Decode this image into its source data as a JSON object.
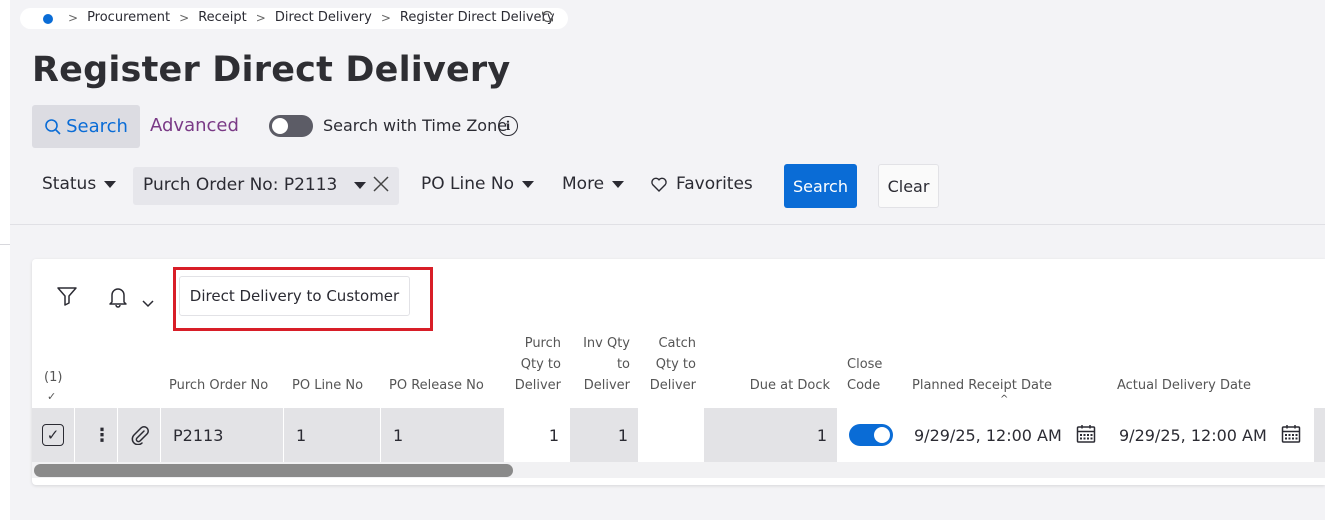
{
  "breadcrumb": {
    "items": [
      "Procurement",
      "Receipt",
      "Direct Delivery",
      "Register Direct Delivery"
    ],
    "separator": ">",
    "refresh_icon": "refresh-icon"
  },
  "page_title": "Register Direct Delivery",
  "search_modes": {
    "search_label": "Search",
    "advanced_label": "Advanced",
    "time_zone_label": "Search with Time Zone",
    "time_zone_enabled": false,
    "info_glyph": "i"
  },
  "filters": {
    "status_label": "Status",
    "purch_order_chip": "Purch Order No: P2113",
    "po_line_label": "PO Line No",
    "more_label": "More",
    "favorites_label": "Favorites",
    "search_button": "Search",
    "clear_button": "Clear"
  },
  "toolbar": {
    "command_button": "Direct Delivery to Customer"
  },
  "table": {
    "selection_count": "(1)",
    "selection_check": "✓",
    "headers": {
      "purch_order_no": "Purch Order No",
      "po_line_no": "PO Line No",
      "po_release_no": "PO Release No",
      "purch_qty_1": "Purch",
      "purch_qty_2": "Qty to",
      "purch_qty_3": "Deliver",
      "inv_qty_1": "Inv Qty",
      "inv_qty_2": "to",
      "inv_qty_3": "Deliver",
      "catch_qty_1": "Catch",
      "catch_qty_2": "Qty to",
      "catch_qty_3": "Deliver",
      "due_at_dock": "Due at Dock",
      "close_code_1": "Close",
      "close_code_2": "Code",
      "planned_receipt_date": "Planned Receipt Date",
      "actual_delivery_date": "Actual Delivery Date",
      "sort_indicator": "^"
    },
    "rows": [
      {
        "purch_order_no": "P2113",
        "po_line_no": "1",
        "po_release_no": "1",
        "purch_qty_to_deliver": "1",
        "inv_qty_to_deliver": "1",
        "catch_qty_to_deliver": "",
        "due_at_dock": "1",
        "close_code": true,
        "planned_receipt_date": "9/29/25, 12:00 AM",
        "actual_delivery_date": "9/29/25, 12:00 AM",
        "checkbox_glyph": "✓",
        "kebab_glyph": "⋮"
      }
    ]
  },
  "colors": {
    "accent": "#0a6cd6",
    "advanced_link": "#7a3a86",
    "highlight_border": "#d81e28",
    "page_background": "#f3f3f6"
  }
}
